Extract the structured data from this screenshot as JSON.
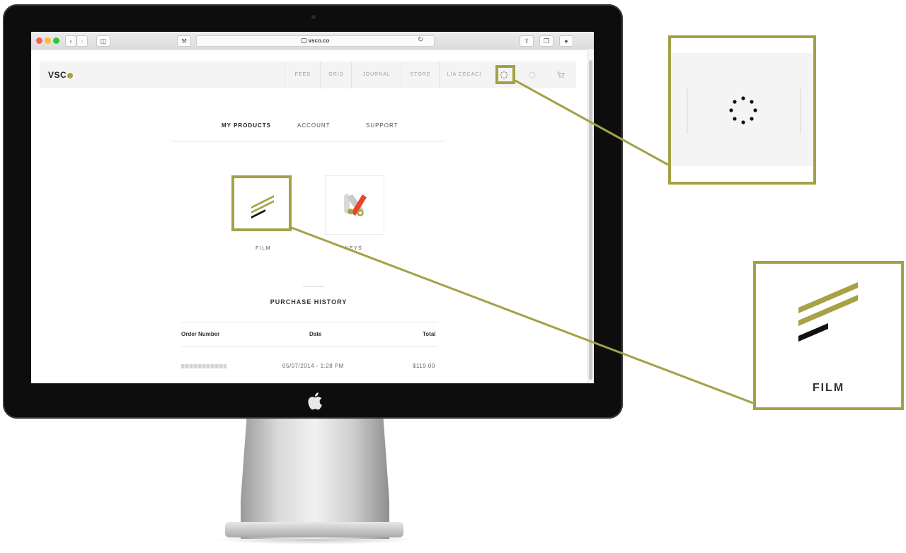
{
  "browser": {
    "url": "vsco.co"
  },
  "site": {
    "logo": "VSC",
    "nav": [
      "FEED",
      "GRID",
      "JOURNAL",
      "STORE",
      "LIA CECACI"
    ]
  },
  "account": {
    "tabs": [
      "MY PRODUCTS",
      "ACCOUNT",
      "SUPPORT"
    ],
    "products": [
      {
        "label": "FILM",
        "icon": "film-stripes-icon"
      },
      {
        "label": "KEYS",
        "icon": "keys-icon"
      }
    ]
  },
  "purchase_history": {
    "title": "PURCHASE HISTORY",
    "columns": [
      "Order Number",
      "Date",
      "Total"
    ],
    "rows": [
      {
        "order": "",
        "date": "05/07/2014 - 1:28 PM",
        "total": "$119.00"
      }
    ]
  },
  "callouts": {
    "film_label": "FILM"
  },
  "colors": {
    "accent": "#a3a146",
    "keys_red": "#e8452c",
    "film_black": "#111111"
  }
}
